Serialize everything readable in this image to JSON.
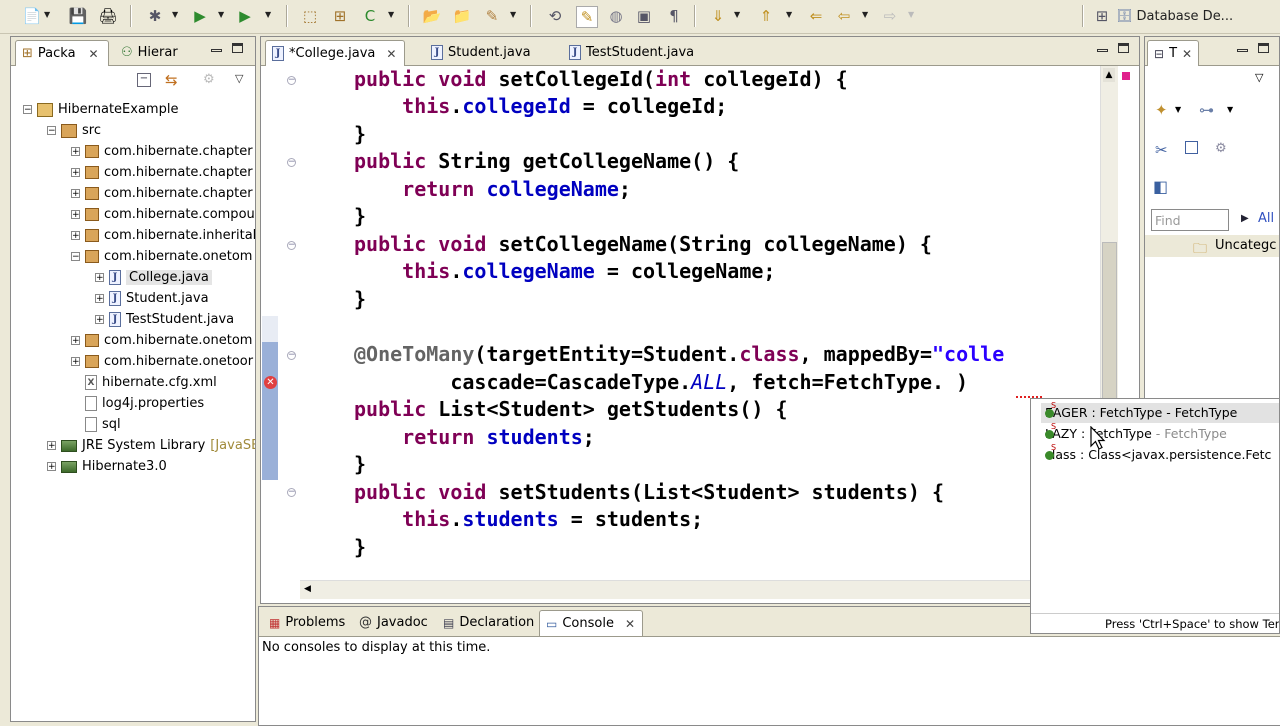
{
  "toolbar": {
    "perspective_label": "Database De..."
  },
  "package_explorer": {
    "tabs": [
      {
        "label": "Packa",
        "close": "✕"
      },
      {
        "label": "Hierar"
      }
    ],
    "tree": [
      {
        "label": "HibernateExample",
        "indent": 0,
        "twisty": "−",
        "icon": "project"
      },
      {
        "label": "src",
        "indent": 1,
        "twisty": "−",
        "icon": "source-folder"
      },
      {
        "label": "com.hibernate.chapter",
        "indent": 2,
        "twisty": "+",
        "icon": "package"
      },
      {
        "label": "com.hibernate.chapter",
        "indent": 2,
        "twisty": "+",
        "icon": "package"
      },
      {
        "label": "com.hibernate.chapter",
        "indent": 2,
        "twisty": "+",
        "icon": "package"
      },
      {
        "label": "com.hibernate.compou",
        "indent": 2,
        "twisty": "+",
        "icon": "package"
      },
      {
        "label": "com.hibernate.inherital",
        "indent": 2,
        "twisty": "+",
        "icon": "package"
      },
      {
        "label": "com.hibernate.onetom",
        "indent": 2,
        "twisty": "−",
        "icon": "package"
      },
      {
        "label": "College.java",
        "indent": 3,
        "twisty": "+",
        "icon": "java",
        "selected": true
      },
      {
        "label": "Student.java",
        "indent": 3,
        "twisty": "+",
        "icon": "java"
      },
      {
        "label": "TestStudent.java",
        "indent": 3,
        "twisty": "+",
        "icon": "java"
      },
      {
        "label": "com.hibernate.onetom",
        "indent": 2,
        "twisty": "+",
        "icon": "package"
      },
      {
        "label": "com.hibernate.onetoor",
        "indent": 2,
        "twisty": "+",
        "icon": "package"
      },
      {
        "label": "hibernate.cfg.xml",
        "indent": 2,
        "twisty": "",
        "icon": "xml"
      },
      {
        "label": "log4j.properties",
        "indent": 2,
        "twisty": "",
        "icon": "file"
      },
      {
        "label": "sql",
        "indent": 2,
        "twisty": "",
        "icon": "file"
      },
      {
        "label": "JRE System Library",
        "suffix": "[JavaSE",
        "indent": 1,
        "twisty": "+",
        "icon": "library"
      },
      {
        "label": "Hibernate3.0",
        "indent": 1,
        "twisty": "+",
        "icon": "library"
      }
    ]
  },
  "editor": {
    "tabs": [
      {
        "label": "*College.java",
        "close": "✕",
        "active": true
      },
      {
        "label": "Student.java"
      },
      {
        "label": "TestStudent.java"
      }
    ]
  },
  "outline": {
    "tab_label": "T",
    "tab_close": "✕",
    "find_placeholder": "Find",
    "all_label": "All",
    "uncategorized_label": "Uncategc"
  },
  "autocomplete": {
    "items": [
      {
        "name": "EAGER",
        "sep": " : ",
        "type": "FetchType",
        "dash": " - ",
        "owner": "FetchType",
        "selected": true
      },
      {
        "name": "LAZY",
        "sep": " : ",
        "type": "FetchType",
        "dash": " - ",
        "owner": "FetchType",
        "selected": false
      },
      {
        "name": "class",
        "sep": " : ",
        "type": "Class<javax.persistence.Fetc",
        "dash": "",
        "owner": "",
        "selected": false
      }
    ],
    "footer": "Press 'Ctrl+Space' to show Temp"
  },
  "bottom_panel": {
    "tabs": [
      {
        "label": "Problems"
      },
      {
        "label": "Javadoc"
      },
      {
        "label": "Declaration"
      },
      {
        "label": "Console",
        "close": "✕",
        "active": true
      }
    ],
    "message": "No consoles to display at this time."
  }
}
